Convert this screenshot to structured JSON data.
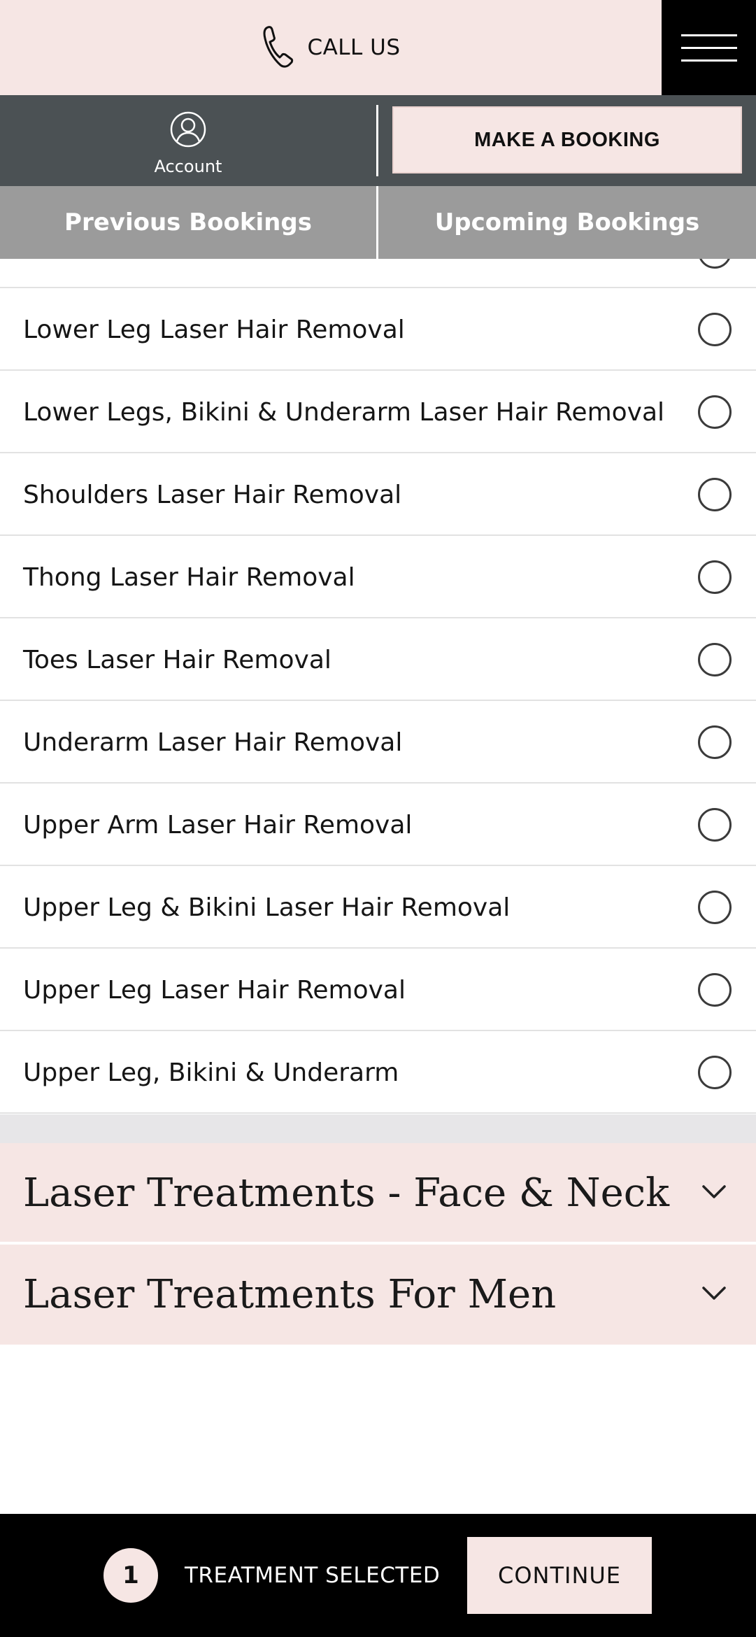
{
  "header": {
    "call_label": "CALL US",
    "phone_icon": "phone-icon",
    "menu_icon": "hamburger-menu-icon"
  },
  "account_bar": {
    "account_label": "Account",
    "account_icon": "user-circle-icon",
    "booking_label": "MAKE A BOOKING"
  },
  "tabs": {
    "previous": "Previous Bookings",
    "upcoming": "Upcoming Bookings"
  },
  "treatments": [
    {
      "label": "Lower Leg Laser Hair Removal",
      "selected": false
    },
    {
      "label": "Lower Legs, Bikini & Underarm Laser Hair Removal",
      "selected": false
    },
    {
      "label": "Shoulders Laser Hair Removal",
      "selected": false
    },
    {
      "label": "Thong Laser Hair Removal",
      "selected": false
    },
    {
      "label": "Toes Laser Hair Removal",
      "selected": false
    },
    {
      "label": "Underarm Laser Hair Removal",
      "selected": false
    },
    {
      "label": "Upper Arm Laser Hair Removal",
      "selected": false
    },
    {
      "label": "Upper Leg & Bikini Laser Hair Removal",
      "selected": false
    },
    {
      "label": "Upper Leg Laser Hair Removal",
      "selected": false
    },
    {
      "label": "Upper Leg, Bikini & Underarm",
      "selected": false
    }
  ],
  "categories": [
    {
      "label": "Laser Treatments - Face & Neck",
      "icon": "chevron-down-icon"
    },
    {
      "label": "Laser Treatments For Men",
      "icon": "chevron-down-icon"
    }
  ],
  "footer": {
    "selected_count": "1",
    "selected_label": "TREATMENT SELECTED",
    "continue_label": "CONTINUE"
  },
  "colors": {
    "blush": "#f6e6e4",
    "charcoal": "#4b5154",
    "tab_grey": "#9b9b9b",
    "black": "#000000"
  }
}
